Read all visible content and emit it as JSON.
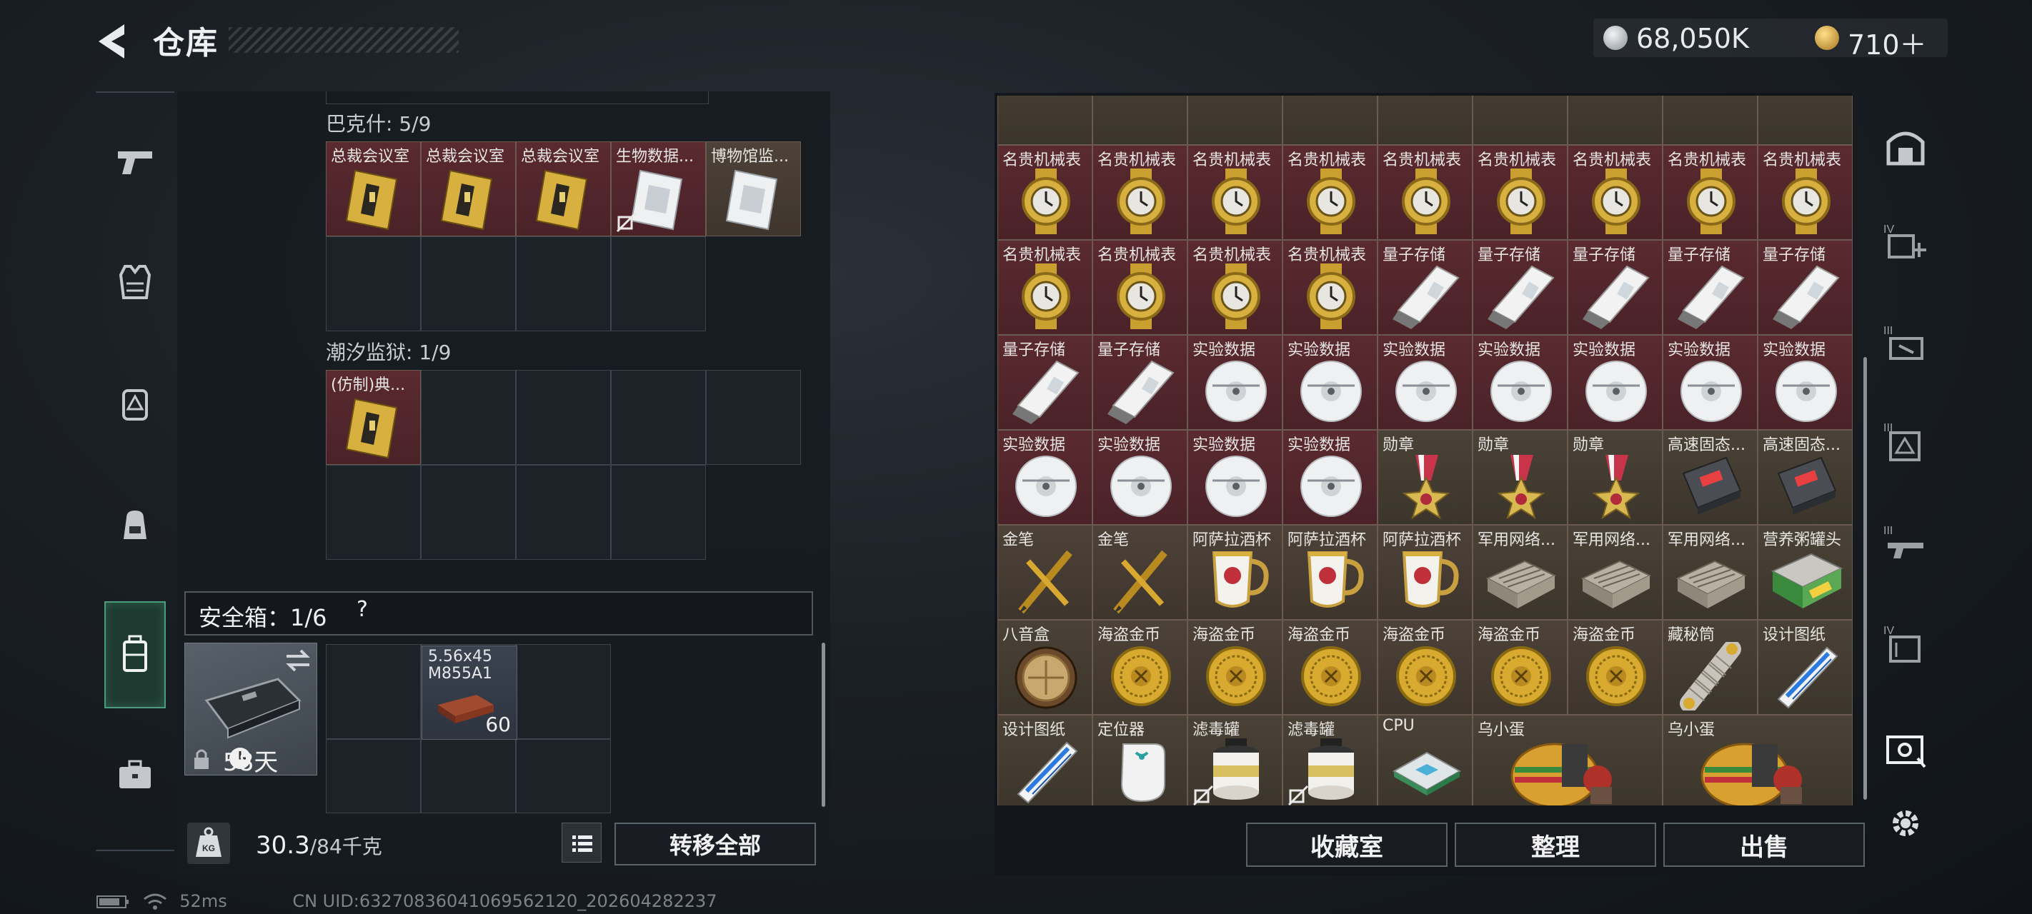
{
  "header": {
    "title": "仓库",
    "currency_1": "68,050K",
    "currency_2": "710＋",
    "colors": {
      "accent_green": "#4a9d7c",
      "currency_silver": "#c8ccd0",
      "currency_gold": "#d9a840"
    }
  },
  "left_sidebar": {
    "items": [
      {
        "icon": "pistol-icon"
      },
      {
        "icon": "vest-icon"
      },
      {
        "icon": "chest-rig-icon"
      },
      {
        "icon": "backpack-icon"
      },
      {
        "icon": "secure-container-icon",
        "active": true
      },
      {
        "icon": "briefcase-icon"
      }
    ]
  },
  "containers": [
    {
      "label": "巴克什: 5/9",
      "items": [
        "总裁会议室",
        "总裁会议室",
        "总裁会议室",
        "生物数据...",
        "博物馆监..."
      ]
    },
    {
      "label": "潮汐监狱: 1/9",
      "items": [
        "(仿制)典..."
      ]
    }
  ],
  "safebox": {
    "title": "安全箱：1/6",
    "help": "?",
    "days": "58天",
    "ammo": {
      "name_line1": "5.56x45",
      "name_line2": "M855A1",
      "count": "60"
    }
  },
  "weight": {
    "current": "30.3",
    "max": "/84千克"
  },
  "buttons": {
    "transfer_all": "转移全部",
    "collection_room": "收藏室",
    "organize": "整理",
    "sell": "出售"
  },
  "status": {
    "ping": "52ms",
    "uid": "CN UID:632708360410695621​20_202604282237"
  },
  "stash_rows": [
    [
      {
        "name": "名贵机械表",
        "icon": "watch"
      },
      {
        "name": "名贵机械表",
        "icon": "watch"
      },
      {
        "name": "名贵机械表",
        "icon": "watch"
      },
      {
        "name": "名贵机械表",
        "icon": "watch"
      },
      {
        "name": "名贵机械表",
        "icon": "watch"
      },
      {
        "name": "名贵机械表",
        "icon": "watch"
      },
      {
        "name": "名贵机械表",
        "icon": "watch"
      },
      {
        "name": "名贵机械表",
        "icon": "watch"
      },
      {
        "name": "名贵机械表",
        "icon": "watch"
      }
    ],
    [
      {
        "name": "名贵机械表",
        "icon": "watch"
      },
      {
        "name": "名贵机械表",
        "icon": "watch"
      },
      {
        "name": "名贵机械表",
        "icon": "watch"
      },
      {
        "name": "名贵机械表",
        "icon": "watch"
      },
      {
        "name": "量子存储",
        "icon": "usb"
      },
      {
        "name": "量子存储",
        "icon": "usb"
      },
      {
        "name": "量子存储",
        "icon": "usb"
      },
      {
        "name": "量子存储",
        "icon": "usb"
      },
      {
        "name": "量子存储",
        "icon": "usb"
      }
    ],
    [
      {
        "name": "量子存储",
        "icon": "usb"
      },
      {
        "name": "量子存储",
        "icon": "usb"
      },
      {
        "name": "实验数据",
        "icon": "disc"
      },
      {
        "name": "实验数据",
        "icon": "disc"
      },
      {
        "name": "实验数据",
        "icon": "disc"
      },
      {
        "name": "实验数据",
        "icon": "disc"
      },
      {
        "name": "实验数据",
        "icon": "disc"
      },
      {
        "name": "实验数据",
        "icon": "disc"
      },
      {
        "name": "实验数据",
        "icon": "disc"
      }
    ],
    [
      {
        "name": "实验数据",
        "icon": "disc"
      },
      {
        "name": "实验数据",
        "icon": "disc"
      },
      {
        "name": "实验数据",
        "icon": "disc"
      },
      {
        "name": "实验数据",
        "icon": "disc"
      },
      {
        "name": "勋章",
        "icon": "medal"
      },
      {
        "name": "勋章",
        "icon": "medal"
      },
      {
        "name": "勋章",
        "icon": "medal"
      },
      {
        "name": "高速固态...",
        "icon": "ssd"
      },
      {
        "name": "高速固态...",
        "icon": "ssd"
      }
    ],
    [
      {
        "name": "金笔",
        "icon": "pen"
      },
      {
        "name": "金笔",
        "icon": "pen"
      },
      {
        "name": "阿萨拉酒杯",
        "icon": "cup"
      },
      {
        "name": "阿萨拉酒杯",
        "icon": "cup"
      },
      {
        "name": "阿萨拉酒杯",
        "icon": "cup"
      },
      {
        "name": "军用网络...",
        "icon": "router"
      },
      {
        "name": "军用网络...",
        "icon": "router"
      },
      {
        "name": "军用网络...",
        "icon": "router"
      },
      {
        "name": "营养粥罐头",
        "icon": "can"
      }
    ],
    [
      {
        "name": "八音盒",
        "icon": "musicbox"
      },
      {
        "name": "海盗金币",
        "icon": "coin"
      },
      {
        "name": "海盗金币",
        "icon": "coin"
      },
      {
        "name": "海盗金币",
        "icon": "coin"
      },
      {
        "name": "海盗金币",
        "icon": "coin"
      },
      {
        "name": "海盗金币",
        "icon": "coin"
      },
      {
        "name": "海盗金币",
        "icon": "coin"
      },
      {
        "name": "藏秘筒",
        "icon": "cryptex"
      },
      {
        "name": "设计图纸",
        "icon": "blueprint"
      }
    ],
    [
      {
        "name": "设计图纸",
        "icon": "blueprint"
      },
      {
        "name": "定位器",
        "icon": "tracker"
      },
      {
        "name": "滤毒罐",
        "icon": "filter"
      },
      {
        "name": "滤毒罐",
        "icon": "filter"
      },
      {
        "name": "CPU",
        "icon": "cpu"
      },
      {
        "name": "乌小蛋",
        "icon": "egg",
        "wide": true
      },
      {
        "name": "乌小蛋",
        "icon": "egg",
        "wide": true
      }
    ]
  ]
}
